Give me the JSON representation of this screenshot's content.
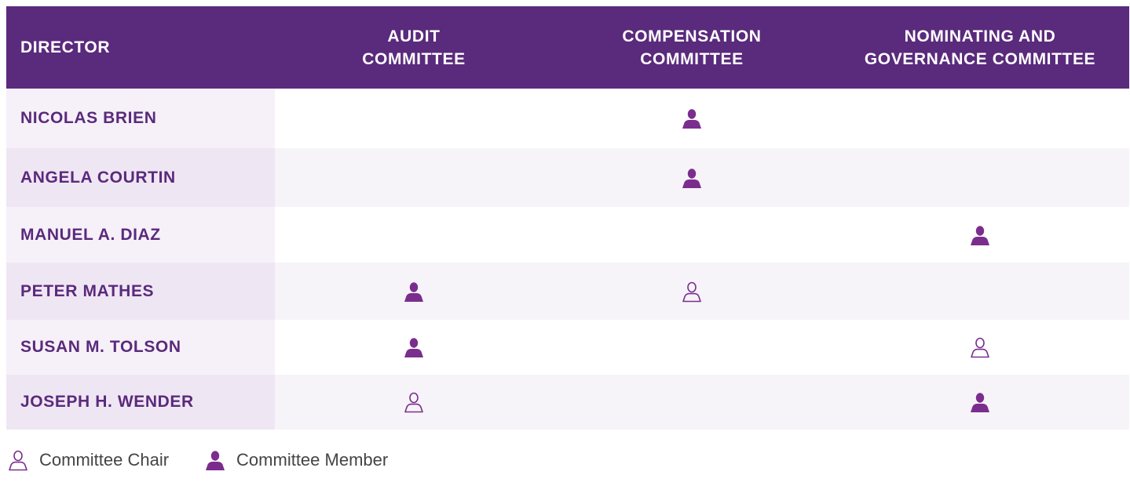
{
  "columns": {
    "director": "DIRECTOR",
    "audit": "AUDIT\nCOMMITTEE",
    "compensation": "COMPENSATION\nCOMMITTEE",
    "nominating": "NOMINATING AND\nGOVERNANCE COMMITTEE"
  },
  "rows": [
    {
      "name": "NICOLAS BRIEN",
      "audit": "",
      "compensation": "member",
      "nominating": ""
    },
    {
      "name": "ANGELA COURTIN",
      "audit": "",
      "compensation": "member",
      "nominating": ""
    },
    {
      "name": "MANUEL A. DIAZ",
      "audit": "",
      "compensation": "",
      "nominating": "member"
    },
    {
      "name": "PETER MATHES",
      "audit": "member",
      "compensation": "chair",
      "nominating": ""
    },
    {
      "name": "SUSAN M. TOLSON",
      "audit": "member",
      "compensation": "",
      "nominating": "chair"
    },
    {
      "name": "JOSEPH H. WENDER",
      "audit": "chair",
      "compensation": "",
      "nominating": "member"
    }
  ],
  "legend": {
    "chair_label": "Committee Chair",
    "member_label": "Committee Member"
  },
  "colors": {
    "header_bg": "#5a2a7c",
    "accent": "#7b2d8e"
  },
  "icons": {
    "chair": "person-outline-icon",
    "member": "person-filled-icon"
  }
}
